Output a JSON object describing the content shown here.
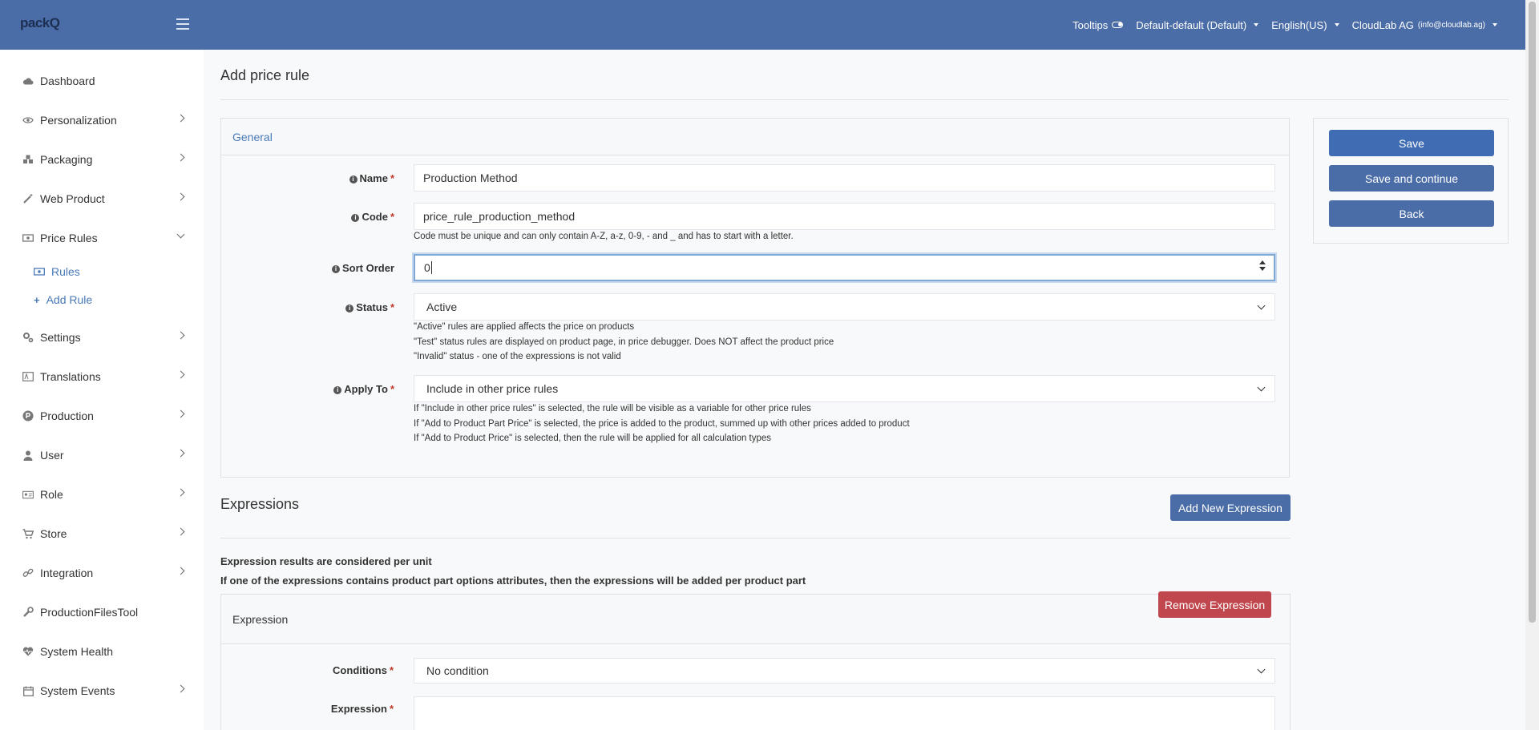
{
  "header": {
    "logo": "packQ",
    "tooltips_label": "Tooltips",
    "store_view": "Default-default (Default)",
    "language": "English(US)",
    "account_name": "CloudLab AG",
    "account_email": "(info@cloudlab.ag)"
  },
  "sidebar": {
    "items": [
      {
        "label": "Dashboard",
        "icon": "cloud-icon"
      },
      {
        "label": "Personalization",
        "icon": "eye-icon"
      },
      {
        "label": "Packaging",
        "icon": "boxes-icon"
      },
      {
        "label": "Web Product",
        "icon": "magic-wand-icon"
      },
      {
        "label": "Price Rules",
        "icon": "money-icon"
      },
      {
        "label": "Settings",
        "icon": "cogs-icon"
      },
      {
        "label": "Translations",
        "icon": "language-icon"
      },
      {
        "label": "Production",
        "icon": "product-hunt-icon"
      },
      {
        "label": "User",
        "icon": "user-icon"
      },
      {
        "label": "Role",
        "icon": "id-card-icon"
      },
      {
        "label": "Store",
        "icon": "cart-icon"
      },
      {
        "label": "Integration",
        "icon": "link-icon"
      },
      {
        "label": "ProductionFilesTool",
        "icon": "wrench-icon"
      },
      {
        "label": "System Health",
        "icon": "heartbeat-icon"
      },
      {
        "label": "System Events",
        "icon": "calendar-icon"
      }
    ],
    "sub_items": [
      {
        "label": "Rules",
        "icon": "money-bill-icon"
      },
      {
        "label": "Add Rule",
        "icon": "plus-icon"
      }
    ]
  },
  "page": {
    "title": "Add price rule",
    "general_header": "General"
  },
  "form": {
    "name_label": "Name",
    "name_value": "Production Method",
    "code_label": "Code",
    "code_value": "price_rule_production_method",
    "code_help": "Code must be unique and can only contain A-Z, a-z, 0-9, - and _ and has to start with a letter.",
    "sort_label": "Sort Order",
    "sort_value": "0",
    "status_label": "Status",
    "status_value": "Active",
    "status_help_1": "\"Active\" rules are applied affects the price on products",
    "status_help_2": "\"Test\" status rules are displayed on product page, in price debugger. Does NOT affect the product price",
    "status_help_3": "\"Invalid\" status - one of the expressions is not valid",
    "apply_label": "Apply To",
    "apply_value": "Include in other price rules",
    "apply_help_1": "If \"Include in other price rules\" is selected, the rule will be visible as a variable for other price rules",
    "apply_help_2": "If \"Add to Product Part Price\" is selected, the price is added to the product, summed up with other prices added to product",
    "apply_help_3": "If \"Add to Product Price\" is selected, then the rule will be applied for all calculation types",
    "required_mark": "*",
    "info_glyph": "i"
  },
  "actions": {
    "save": "Save",
    "save_continue": "Save and continue",
    "back": "Back"
  },
  "expressions": {
    "title": "Expressions",
    "add_button": "Add New Expression",
    "note_1": "Expression results are considered per unit",
    "note_2": "If one of the expressions contains product part options attributes, then the expressions will be added per product part",
    "card_title": "Expression",
    "remove_button": "Remove Expression",
    "conditions_label": "Conditions",
    "conditions_value": "No condition",
    "expression_label": "Expression",
    "expression_value": ""
  },
  "colors": {
    "topbar": "#4a6da7",
    "primary_button": "#3f6cb3",
    "danger_button": "#c0474d",
    "link": "#4a7ab8"
  }
}
